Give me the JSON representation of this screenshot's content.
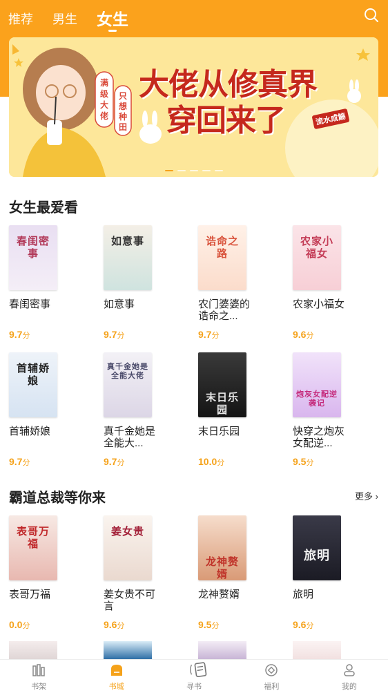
{
  "header": {
    "tabs": [
      {
        "label": "推荐",
        "active": false
      },
      {
        "label": "男生",
        "active": false
      },
      {
        "label": "女生",
        "active": true
      }
    ],
    "accent_color": "#fba21c"
  },
  "banner": {
    "title_line1": "大佬从修真界",
    "title_line2": "穿回来了",
    "tag": "流水成觞",
    "side_left": "满级大佬",
    "side_right": "只想种田",
    "slides": 5,
    "active_slide": 0
  },
  "section1": {
    "title": "女生最爱看",
    "books": [
      {
        "title": "春闺密事",
        "cover_text": "春闺密事",
        "score": "9.7",
        "unit": "分",
        "color": "#e8e0f0"
      },
      {
        "title": "如意事",
        "cover_text": "如意事",
        "score": "9.7",
        "unit": "分",
        "color": "#cfe3df"
      },
      {
        "title": "农门婆婆的诰命之...",
        "cover_text": "诰命之路",
        "score": "9.7",
        "unit": "分",
        "color": "#fbe3d4"
      },
      {
        "title": "农家小福女",
        "cover_text": "农家小福女",
        "score": "9.6",
        "unit": "分",
        "color": "#f9d8de"
      },
      {
        "title": "首辅娇娘",
        "cover_text": "首辅娇娘",
        "score": "9.7",
        "unit": "分",
        "color": "#e3edf7"
      },
      {
        "title": "真千金她是全能大...",
        "cover_text": "真千金她是全能大佬",
        "score": "9.7",
        "unit": "分",
        "color": "#eae7f0"
      },
      {
        "title": "末日乐园",
        "cover_text": "末日乐园",
        "score": "10.0",
        "unit": "分",
        "color": "#2a2a2a"
      },
      {
        "title": "快穿之炮灰女配逆...",
        "cover_text": "炮灰女配逆袭记",
        "score": "9.5",
        "unit": "分",
        "color": "#e6d2f2"
      }
    ]
  },
  "section2": {
    "title": "霸道总裁等你来",
    "more_label": "更多",
    "books": [
      {
        "title": "表哥万福",
        "cover_text": "表哥万福",
        "score": "0.0",
        "unit": "分",
        "color": "#f3dcd8"
      },
      {
        "title": "姜女贵不可言",
        "cover_text": "姜女贵",
        "score": "9.6",
        "unit": "分",
        "color": "#f6efe9"
      },
      {
        "title": "龙神赘婿",
        "cover_text": "龙神赘婿",
        "score": "9.5",
        "unit": "分",
        "color": "#f2d4c5"
      },
      {
        "title": "旅明",
        "cover_text": "旅明",
        "score": "9.6",
        "unit": "分",
        "color": "#2b2b36"
      }
    ]
  },
  "bottom_nav": {
    "items": [
      {
        "label": "书架",
        "icon": "bookshelf-icon",
        "active": false
      },
      {
        "label": "书城",
        "icon": "bookstore-icon",
        "active": true
      },
      {
        "label": "寻书",
        "icon": "find-book-icon",
        "active": false
      },
      {
        "label": "福利",
        "icon": "coin-icon",
        "active": false
      },
      {
        "label": "我的",
        "icon": "profile-icon",
        "active": false
      }
    ]
  }
}
